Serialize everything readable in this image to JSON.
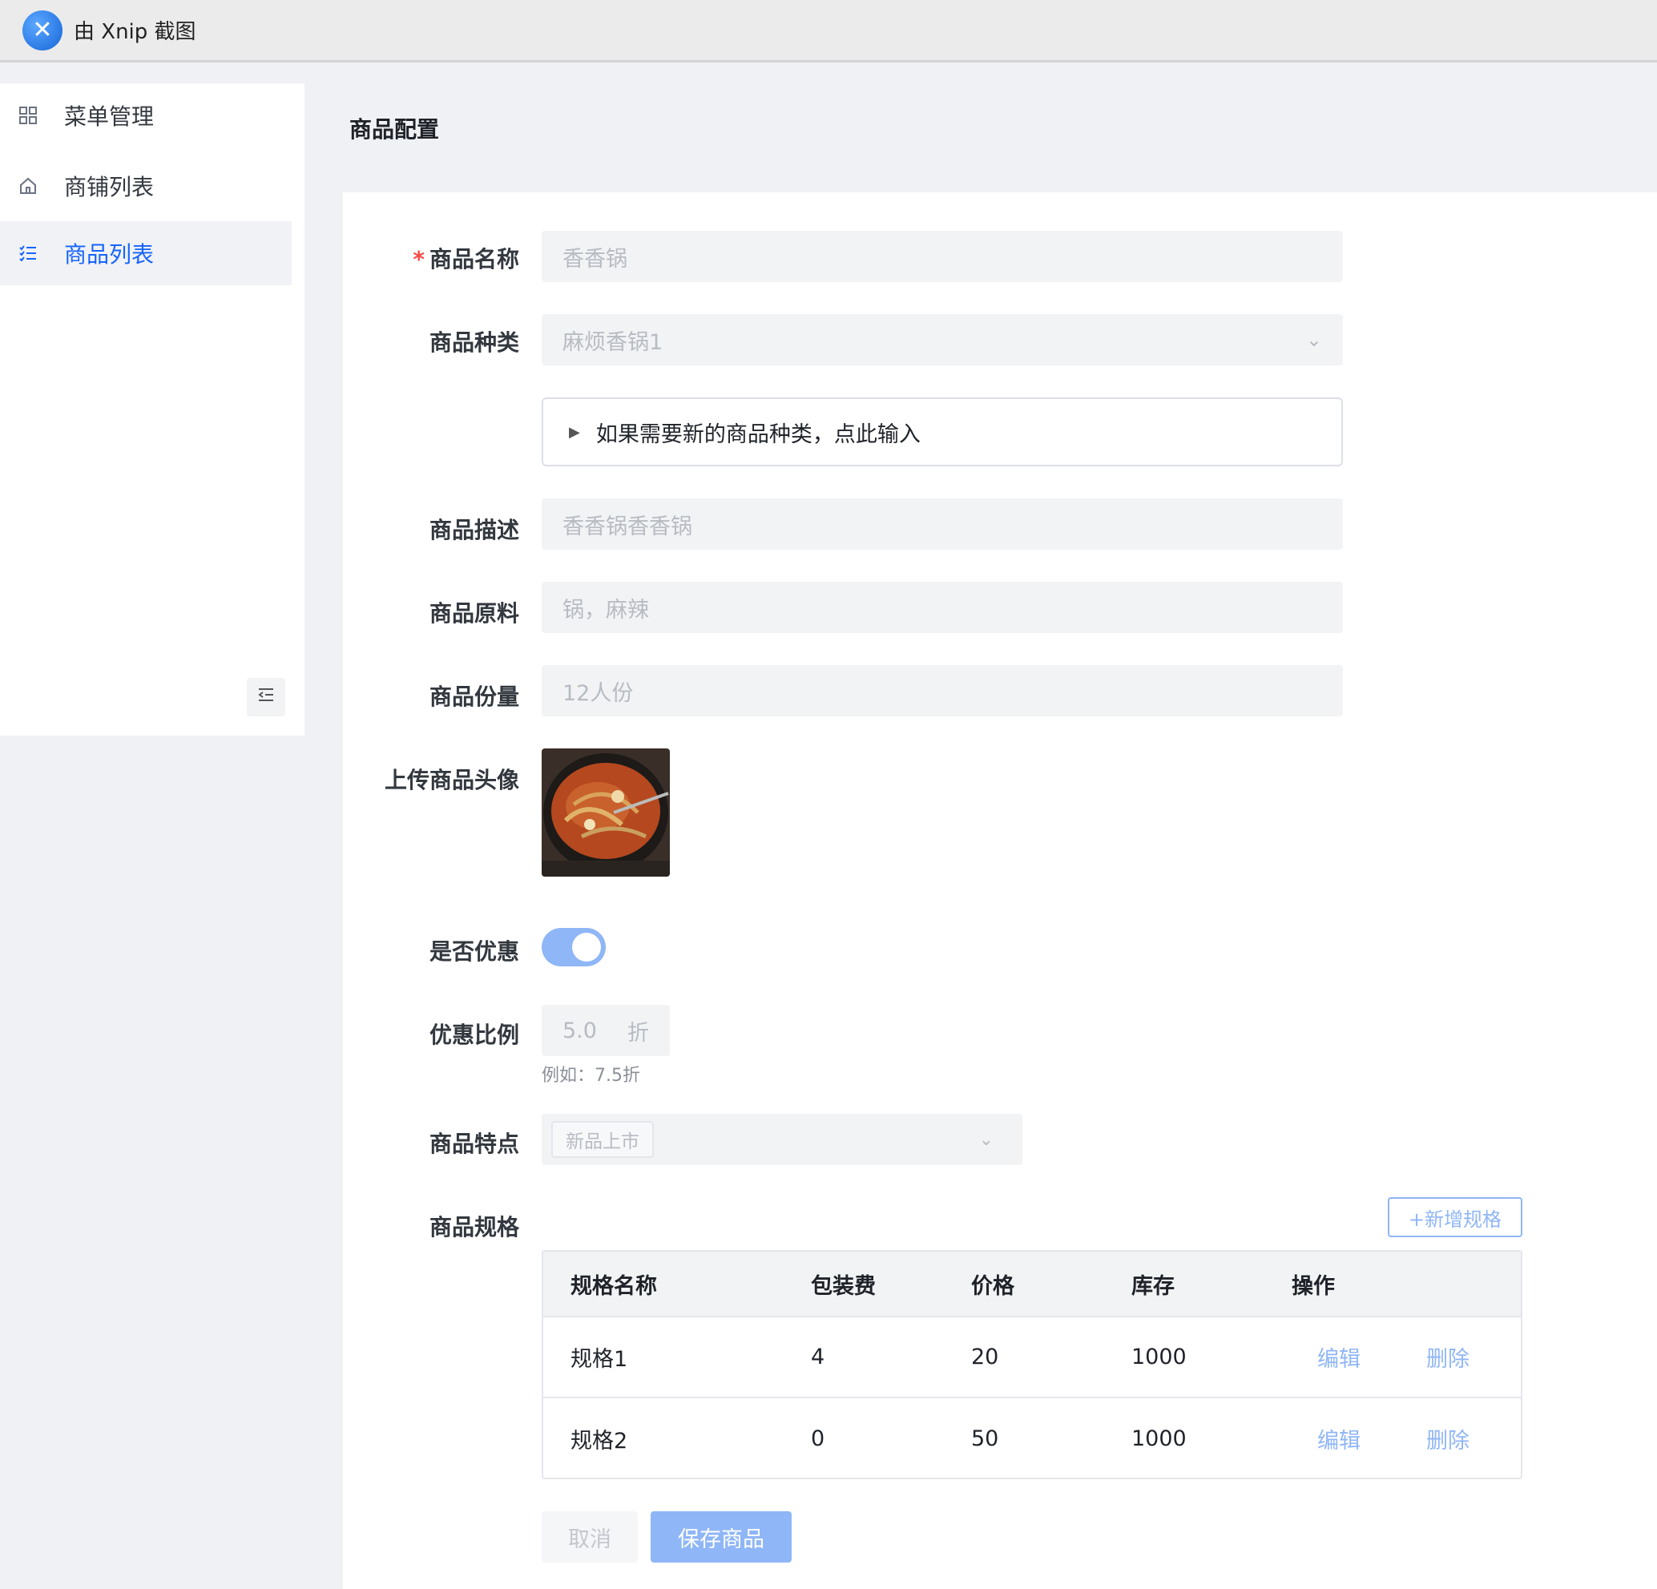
{
  "window": {
    "title": "由 Xnip 截图",
    "logo_icon": "xnip-logo-icon"
  },
  "sidebar": {
    "items": [
      {
        "label": "菜单管理",
        "icon": "grid-icon",
        "active": false
      },
      {
        "label": "商铺列表",
        "icon": "home-icon",
        "active": false
      },
      {
        "label": "商品列表",
        "icon": "list-check-icon",
        "active": true
      }
    ],
    "collapse_icon": "indent-icon"
  },
  "page": {
    "title": "商品配置"
  },
  "form": {
    "name": {
      "label": "商品名称",
      "required": true,
      "value": "香香锅"
    },
    "category": {
      "label": "商品种类",
      "value": "麻烦香锅1"
    },
    "new_category_expander": {
      "text": "如果需要新的商品种类，点此输入"
    },
    "description": {
      "label": "商品描述",
      "value": "香香锅香香锅"
    },
    "ingredients": {
      "label": "商品原料",
      "value": "锅，麻辣"
    },
    "portion": {
      "label": "商品份量",
      "value": "12人份"
    },
    "avatar": {
      "label": "上传商品头像",
      "image_alt": "香锅图片"
    },
    "discount_enabled": {
      "label": "是否优惠",
      "on": true
    },
    "discount_ratio": {
      "label": "优惠比例",
      "value": "5.0",
      "unit": "折",
      "hint": "例如：7.5折"
    },
    "features": {
      "label": "商品特点",
      "selected_tag": "新品上市"
    },
    "specs": {
      "label": "商品规格",
      "add_button": "+新增规格",
      "columns": [
        "规格名称",
        "包装费",
        "价格",
        "库存",
        "操作"
      ],
      "rows": [
        {
          "name": "规格1",
          "packing_fee": "4",
          "price": "20",
          "stock": "1000",
          "edit": "编辑",
          "delete": "删除"
        },
        {
          "name": "规格2",
          "packing_fee": "0",
          "price": "50",
          "stock": "1000",
          "edit": "编辑",
          "delete": "删除"
        }
      ]
    }
  },
  "actions": {
    "cancel": "取消",
    "save": "保存商品"
  },
  "colors": {
    "primary": "#1664ff",
    "primary_light": "#8fb6f6",
    "required": "#f54a45"
  }
}
